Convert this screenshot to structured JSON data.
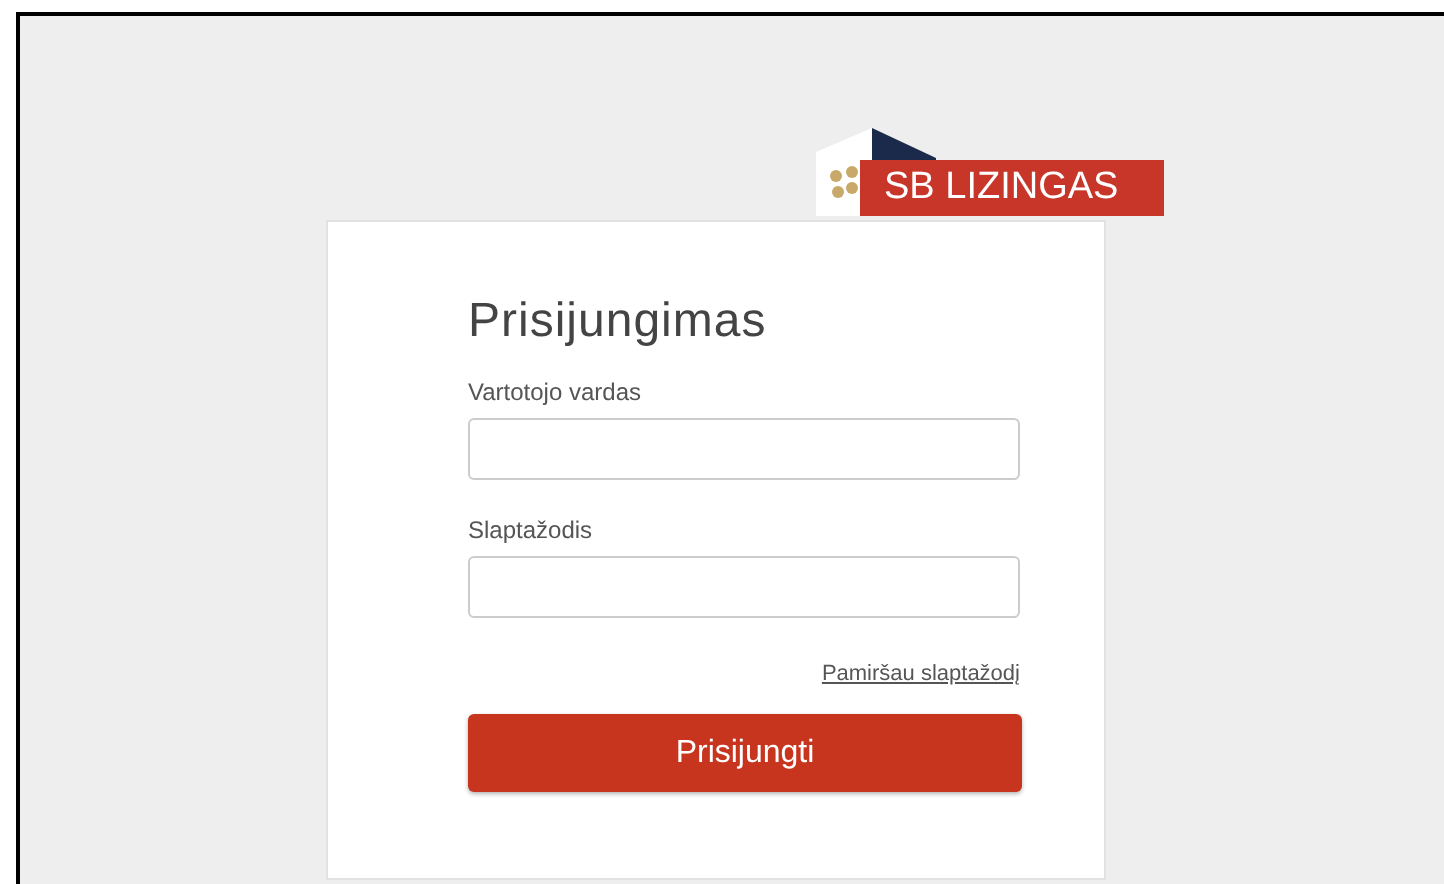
{
  "logo": {
    "text": "SB LIZINGAS"
  },
  "form": {
    "title": "Prisijungimas",
    "fields": [
      {
        "label": "Vartotojo vardas"
      },
      {
        "label": "Slaptažodis"
      }
    ],
    "forgot_link": "Pamiršau slaptažodį",
    "submit": "Prisijungti"
  }
}
